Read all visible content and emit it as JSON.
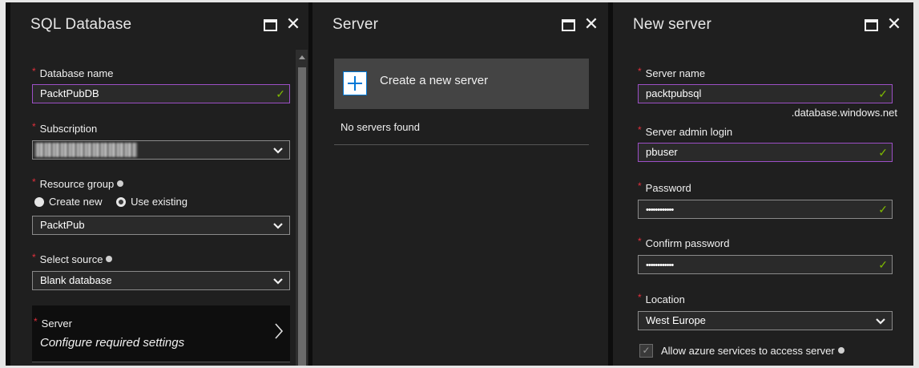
{
  "sql_blade": {
    "title": "SQL Database",
    "database_name": {
      "label": "Database name",
      "value": "PacktPubDB"
    },
    "subscription": {
      "label": "Subscription"
    },
    "resource_group": {
      "label": "Resource group",
      "option_create_new": "Create new",
      "option_use_existing": "Use existing",
      "selected_option": "Use existing",
      "value": "PacktPub"
    },
    "select_source": {
      "label": "Select source",
      "value": "Blank database"
    },
    "server": {
      "label": "Server",
      "value": "Configure required settings"
    }
  },
  "server_blade": {
    "title": "Server",
    "create_label": "Create a new server",
    "empty_message": "No servers found"
  },
  "new_server_blade": {
    "title": "New server",
    "server_name": {
      "label": "Server name",
      "value": "packtpubsql",
      "suffix": ".database.windows.net"
    },
    "admin_login": {
      "label": "Server admin login",
      "value": "pbuser"
    },
    "password": {
      "label": "Password",
      "value": "••••••••••••"
    },
    "confirm_password": {
      "label": "Confirm password",
      "value": "••••••••••••"
    },
    "location": {
      "label": "Location",
      "value": "West Europe"
    },
    "allow_azure": {
      "label": "Allow azure services to access server",
      "checked": true
    }
  },
  "colors": {
    "required_marker": "#e0303c",
    "valid_border": "#9c4fc6",
    "valid_check": "#7fba00",
    "create_icon": "#0078d7"
  },
  "icons": [
    "maximize-icon",
    "close-icon",
    "check-icon",
    "chevron-down-icon",
    "info-icon",
    "plus-icon",
    "chevron-right-icon"
  ]
}
